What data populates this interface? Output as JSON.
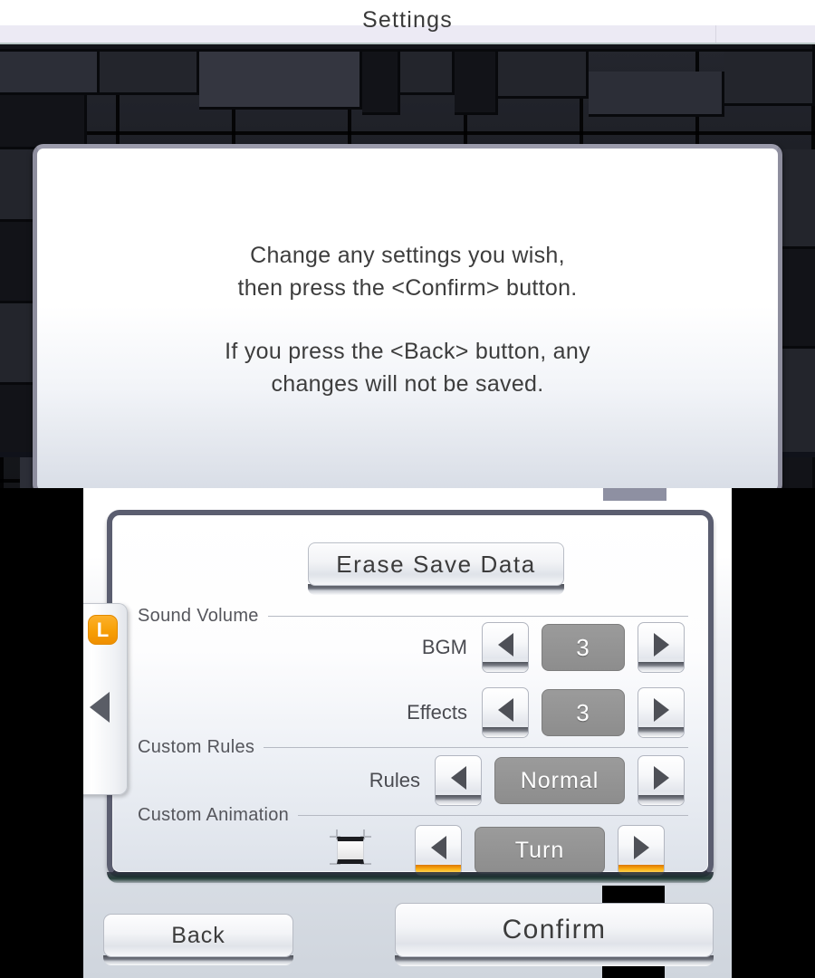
{
  "window": {
    "title": "Settings"
  },
  "top_screen": {
    "dialog": {
      "lines_group_1": [
        "Change any settings you wish,",
        "then press the <Confirm> button."
      ],
      "lines_group_2": [
        "If you press the <Back> button, any",
        "changes will not be saved."
      ]
    }
  },
  "bottom_screen": {
    "erase_button": {
      "label": "Erase Save Data"
    },
    "shoulder_tab": {
      "badge_label": "L",
      "arrow_icon": "triangle-left-icon"
    },
    "sections": [
      {
        "id": "sound-volume",
        "label": "Sound Volume",
        "rows": [
          {
            "id": "bgm",
            "label": "BGM",
            "value": "3",
            "dec_icon": "triangle-left-icon",
            "inc_icon": "triangle-right-icon",
            "accent": "none"
          },
          {
            "id": "effects",
            "label": "Effects",
            "value": "3",
            "dec_icon": "triangle-left-icon",
            "inc_icon": "triangle-right-icon",
            "accent": "none"
          }
        ]
      },
      {
        "id": "custom-rules",
        "label": "Custom Rules",
        "rows": [
          {
            "id": "rules",
            "label": "Rules",
            "value": "Normal",
            "dec_icon": "triangle-left-icon",
            "inc_icon": "triangle-right-icon",
            "accent": "none"
          }
        ]
      },
      {
        "id": "custom-animation",
        "label": "Custom Animation",
        "rows": [
          {
            "id": "animation",
            "label": "",
            "value": "Turn",
            "dec_icon": "triangle-left-icon",
            "inc_icon": "triangle-right-icon",
            "accent": "orange",
            "checkbox": true,
            "checked": false
          }
        ]
      }
    ],
    "actions": {
      "back_label": "Back",
      "confirm_label": "Confirm"
    }
  },
  "colors": {
    "accent_orange": "#f79f06",
    "value_box_gray": "#949494",
    "frame_border": "#5b5e70",
    "dialog_border": "#9b9bab",
    "title_text": "#3a3a3a"
  }
}
